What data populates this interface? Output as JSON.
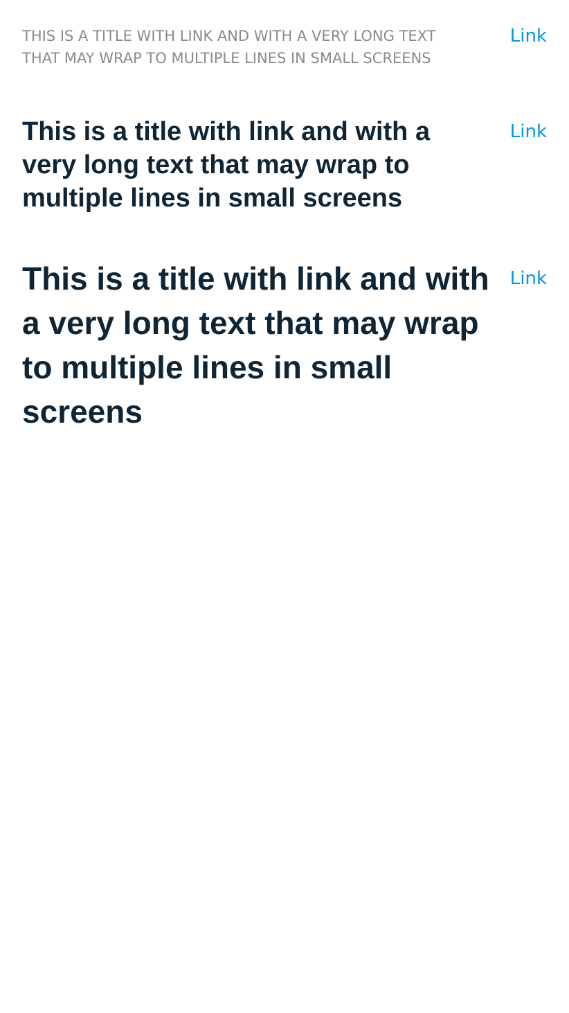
{
  "titles": [
    {
      "text": "This is a title with link and with a very long text that may wrap to multiple lines in small screens",
      "link_label": "Link",
      "style": "small-uppercase"
    },
    {
      "text": "This is a title with link and with a very long text that may wrap to multiple lines in small screens",
      "link_label": "Link",
      "style": "medium-bold"
    },
    {
      "text": "This is a title with link and with a very long text that may wrap to multiple lines in small screens",
      "link_label": "Link",
      "style": "large-bold"
    }
  ],
  "colors": {
    "link": "#0099e0",
    "title_dark": "#0f2536",
    "title_muted": "#8a8a8e",
    "background": "#ffffff"
  }
}
